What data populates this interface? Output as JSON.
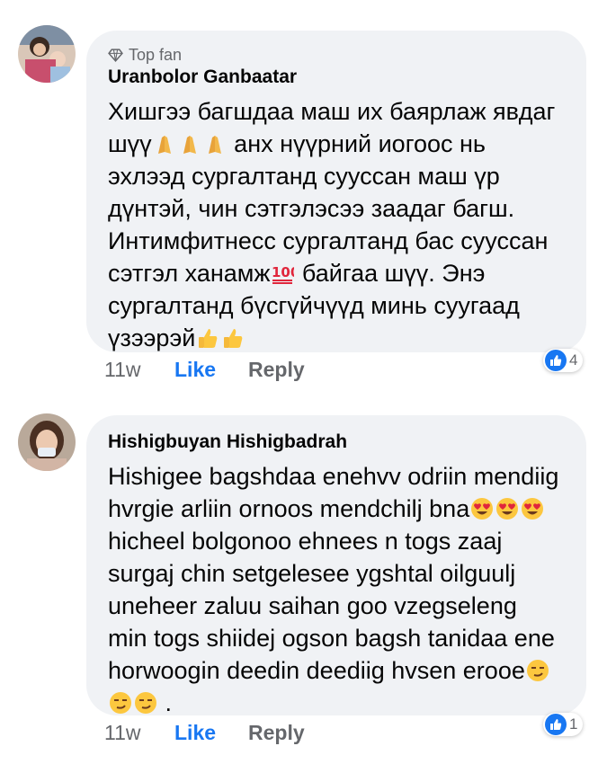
{
  "comments": [
    {
      "badge": "Top fan",
      "author": "Uranbolor Ganbaatar",
      "text_parts": [
        "Хишгээ багшдаа маш их баярлаж явдаг шүү",
        " анх нүүрний иогоос нь эхлээд сургалтанд сууссан маш үр дүнтэй, чин сэтгэлэсээ заадаг багш. Интимфитнесс сургалтанд бас сууссан сэтгэл ханамж",
        " байгаа шүү. Энэ сургалтанд бүсгүйчүүд минь суугаад үзээрэй"
      ],
      "time": "11w",
      "like_label": "Like",
      "reply_label": "Reply",
      "reaction_count": "4"
    },
    {
      "author": "Hishigbuyan  Hishigbadrah",
      "text_parts": [
        "Hishigee bagshdaa enehvv odriin mendiig hvrgie arliin ornoos mendchilj bna",
        " hicheel bolgonoo ehnees n togs zaaj surgaj chin setgelesee ygshtal oilguulj uneheer zaluu saihan goo vzegseleng min togs shiidej ogson bagsh tanidaa ene horwoogin deedin deediig hvsen erooe",
        " ."
      ],
      "time": "11w",
      "like_label": "Like",
      "reply_label": "Reply",
      "reaction_count": "1"
    }
  ],
  "colors": {
    "bubble": "#f0f2f5",
    "like_blue": "#1877f2",
    "secondary_text": "#65676b"
  },
  "icons": {
    "badge": "diamond-icon",
    "pray": "praying-hands-emoji",
    "hundred": "hundred-points-emoji",
    "thumbs": "thumbs-up-emoji",
    "heart_eyes": "heart-eyes-emoji",
    "smirk": "smirking-face-emoji",
    "reaction": "like-reaction-icon"
  }
}
